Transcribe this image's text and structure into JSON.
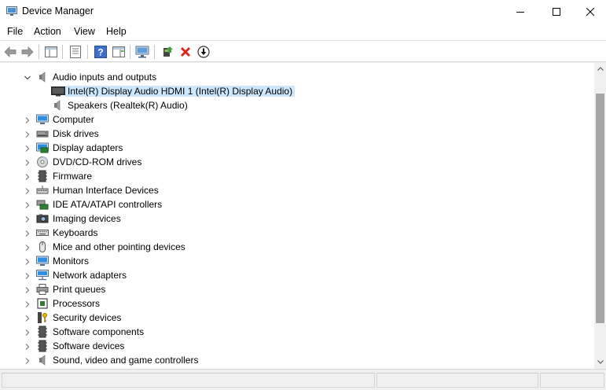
{
  "window": {
    "title": "Device Manager",
    "icon": "device-manager-icon"
  },
  "menu": [
    "File",
    "Action",
    "View",
    "Help"
  ],
  "toolbar": {
    "buttons": [
      "back-arrow-icon",
      "forward-arrow-icon",
      "show-hide-console-tree-icon",
      "properties-icon",
      "help-icon",
      "action-pane-icon",
      "scan-hardware-changes-icon",
      "update-driver-icon",
      "uninstall-device-icon",
      "enable-device-icon"
    ]
  },
  "tree": {
    "expanded_category": {
      "label": "Audio inputs and outputs",
      "children": [
        {
          "label": "Intel(R) Display Audio HDMI 1 (Intel(R) Display Audio)",
          "selected": true
        },
        {
          "label": "Speakers (Realtek(R) Audio)",
          "selected": false
        }
      ]
    },
    "categories": [
      "Computer",
      "Disk drives",
      "Display adapters",
      "DVD/CD-ROM drives",
      "Firmware",
      "Human Interface Devices",
      "IDE ATA/ATAPI controllers",
      "Imaging devices",
      "Keyboards",
      "Mice and other pointing devices",
      "Monitors",
      "Network adapters",
      "Print queues",
      "Processors",
      "Security devices",
      "Software components",
      "Software devices",
      "Sound, video and game controllers"
    ]
  },
  "colors": {
    "selection": "#cce8ff",
    "scroll_thumb": "#a6a6a6"
  }
}
